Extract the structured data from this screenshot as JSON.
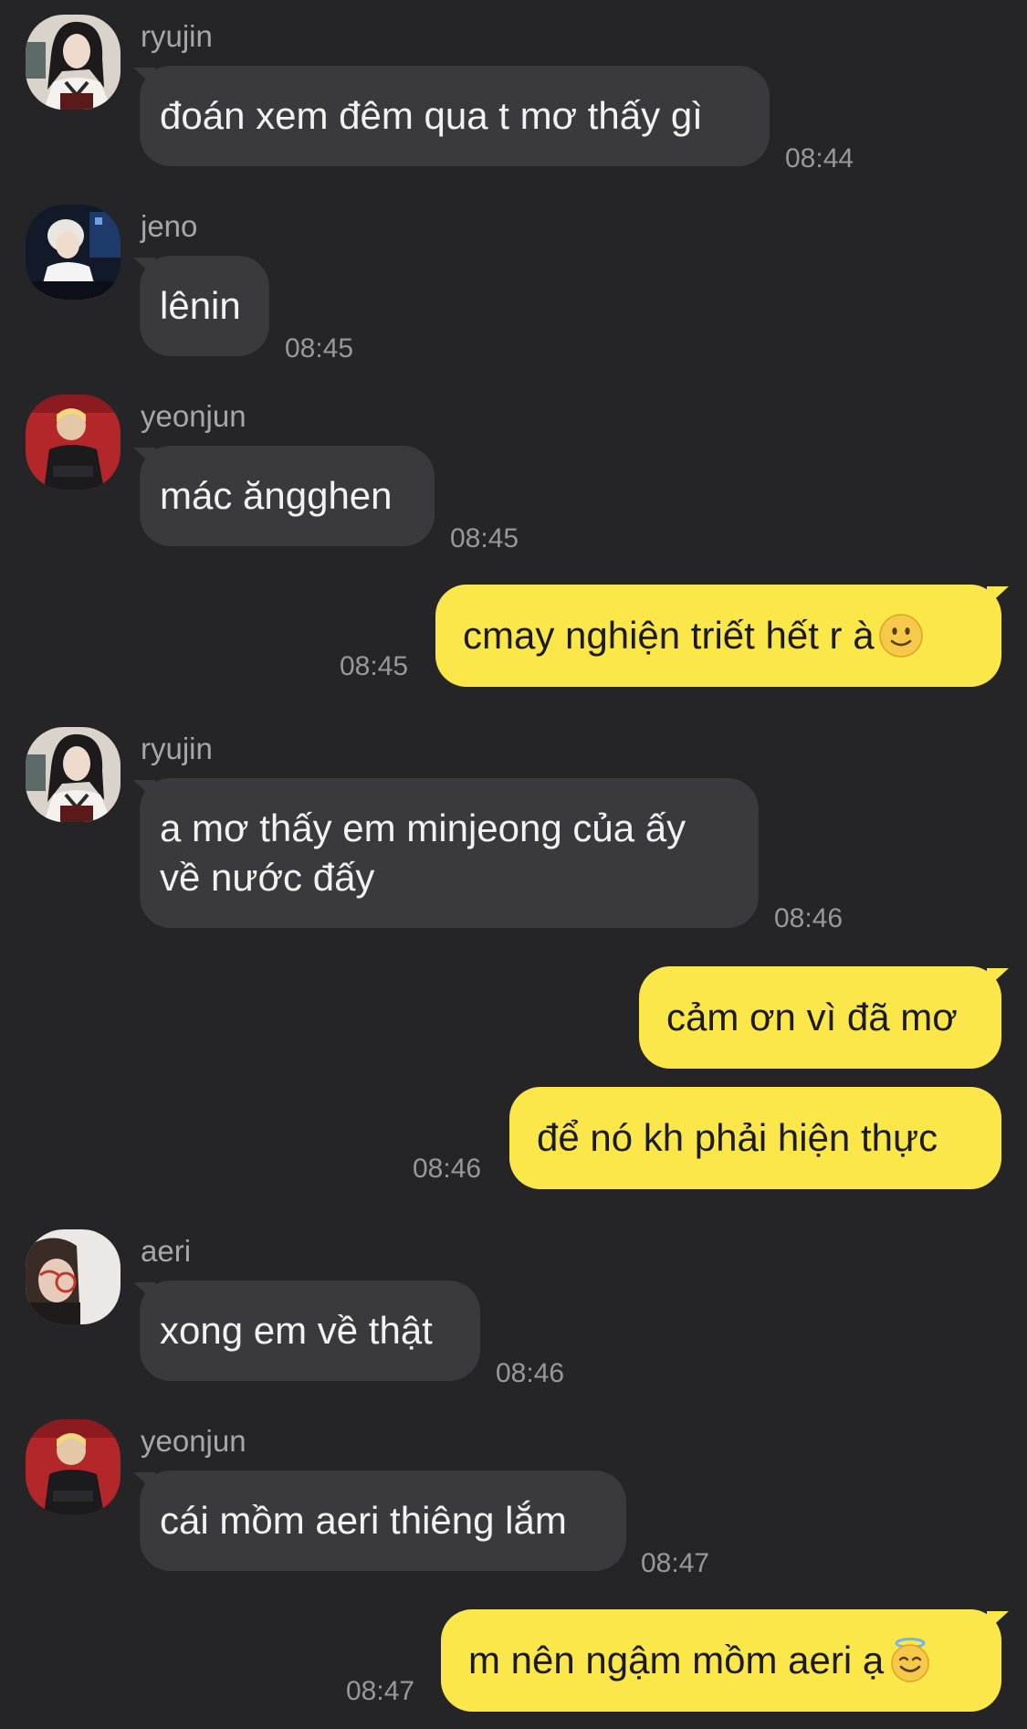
{
  "messages": [
    {
      "sender": "ryujin",
      "text": "đoán xem đêm qua t mơ thấy gì",
      "time": "08:44"
    },
    {
      "sender": "jeno",
      "text": "lênin",
      "time": "08:45"
    },
    {
      "sender": "yeonjun",
      "text": "mác ăngghen",
      "time": "08:45"
    },
    {
      "sender": "me",
      "text": "cmay nghiện triết hết r à",
      "emoji": "slightly-smiling-face",
      "time": "08:45"
    },
    {
      "sender": "ryujin",
      "lines": [
        "a mơ thấy em minjeong của ấy",
        "về nước đấy"
      ],
      "time": "08:46"
    },
    {
      "sender": "me",
      "text": "cảm ơn vì đã mơ"
    },
    {
      "sender": "me",
      "text": "để nó kh phải hiện thực",
      "time": "08:46"
    },
    {
      "sender": "aeri",
      "text": "xong em về thật",
      "time": "08:46"
    },
    {
      "sender": "yeonjun",
      "text": "cái mồm aeri thiêng lắm",
      "time": "08:47"
    },
    {
      "sender": "me",
      "text": "m nên ngậm mồm aeri ạ",
      "emoji": "smiling-face-with-halo",
      "time": "08:47"
    }
  ],
  "colors": {
    "background": "#252528",
    "incoming_bubble": "#3a3a3e",
    "outgoing_bubble": "#fbe74a",
    "sender_name": "#a7a7aa",
    "timestamp": "#98989b"
  }
}
